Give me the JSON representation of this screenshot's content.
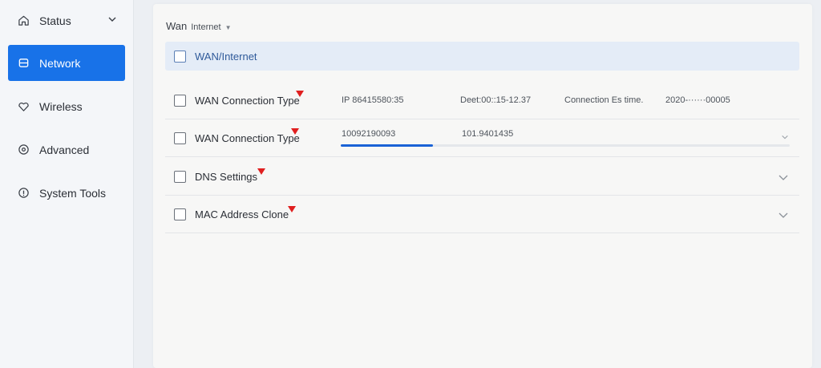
{
  "sidebar": {
    "items": [
      {
        "label": "Status",
        "icon": "home-icon",
        "active": false,
        "has_chevron": true
      },
      {
        "label": "Network",
        "icon": "network-icon",
        "active": true
      },
      {
        "label": "Wireless",
        "icon": "wireless-icon",
        "active": false
      },
      {
        "label": "Advanced",
        "icon": "advanced-icon",
        "active": false
      },
      {
        "label": "System Tools",
        "icon": "system-tools-icon",
        "active": false
      }
    ]
  },
  "breadcrumb": {
    "main": "Wan",
    "sub": "Internet"
  },
  "section": {
    "title": "WAN/Internet"
  },
  "rows": [
    {
      "label": "WAN Connection Type",
      "ip": "IP 86415580:35",
      "detail": "Deet:00::15-12.37",
      "conn_label": "Connection Es time.",
      "conn_value": "2020-······00005"
    },
    {
      "label": "WAN Connection Type",
      "value_a": "10092190093",
      "value_b": "101.9401435",
      "progress": 0.205
    },
    {
      "label": "DNS Settings"
    },
    {
      "label": "MAC Address Clone"
    }
  ],
  "colors": {
    "accent": "#1872e8",
    "flag": "#e01f1f",
    "progress": "#1a62d6",
    "section_bg": "#e4ecf7"
  }
}
